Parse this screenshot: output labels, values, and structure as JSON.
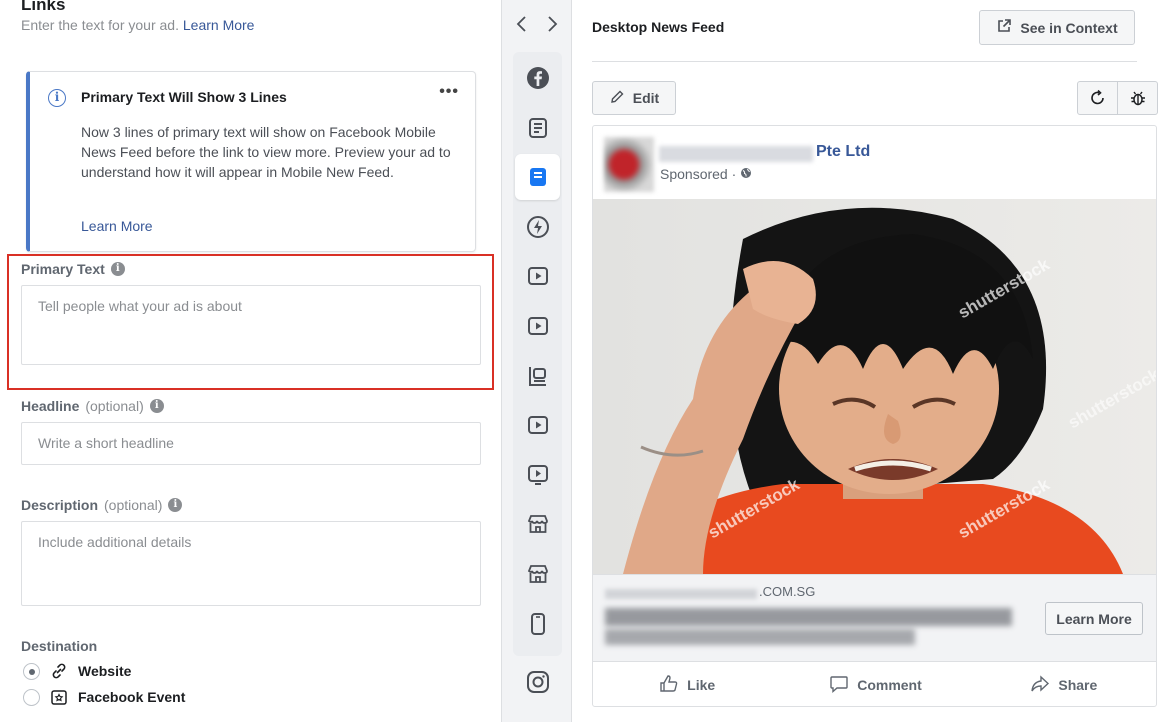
{
  "left_panel": {
    "section_title": "Links",
    "section_subtitle": "Enter the text for your ad.",
    "section_learn_more": "Learn More",
    "info_box": {
      "title": "Primary Text Will Show 3 Lines",
      "more_glyph": "•••",
      "body": "Now 3 lines of primary text will show on Facebook Mobile News Feed before the link to view more. Preview your ad to understand how it will appear in Mobile New Feed.",
      "learn_more": "Learn More"
    },
    "primary_text": {
      "label": "Primary Text",
      "placeholder": "Tell people what your ad is about"
    },
    "headline": {
      "label": "Headline",
      "optional": "(optional)",
      "placeholder": "Write a short headline"
    },
    "description": {
      "label": "Description",
      "optional": "(optional)",
      "placeholder": "Include additional details"
    },
    "destination": {
      "label": "Destination",
      "options": [
        {
          "label": "Website",
          "selected": true,
          "icon": "link-icon"
        },
        {
          "label": "Facebook Event",
          "selected": false,
          "icon": "event-star-icon"
        }
      ]
    }
  },
  "placement_strip": {
    "items": [
      {
        "icon": "facebook-icon",
        "active": false
      },
      {
        "icon": "feed-icon",
        "active": false
      },
      {
        "icon": "desktop-feed-icon",
        "active": true
      },
      {
        "icon": "instant-article-icon",
        "active": false
      },
      {
        "icon": "video-icon",
        "active": false
      },
      {
        "icon": "video-icon",
        "active": false
      },
      {
        "icon": "right-column-icon",
        "active": false
      },
      {
        "icon": "video-icon",
        "active": false
      },
      {
        "icon": "video-feed-icon",
        "active": false
      },
      {
        "icon": "marketplace-icon",
        "active": false
      },
      {
        "icon": "marketplace-icon",
        "active": false
      },
      {
        "icon": "mobile-icon",
        "active": false
      }
    ],
    "bottom_icon": "instagram-icon"
  },
  "preview": {
    "title": "Desktop News Feed",
    "see_in_context": "See in Context",
    "edit": "Edit",
    "post": {
      "page_name_suffix": "Pte Ltd",
      "sponsored": "Sponsored ·",
      "domain_suffix": ".COM.SG",
      "cta": "Learn More",
      "actions": [
        "Like",
        "Comment",
        "Share"
      ],
      "watermark": "shutterstock"
    }
  },
  "colors": {
    "accent": "#385898",
    "info_border": "#4a78c6",
    "highlight_border": "#d93025",
    "shirt": "#e84a1f"
  }
}
